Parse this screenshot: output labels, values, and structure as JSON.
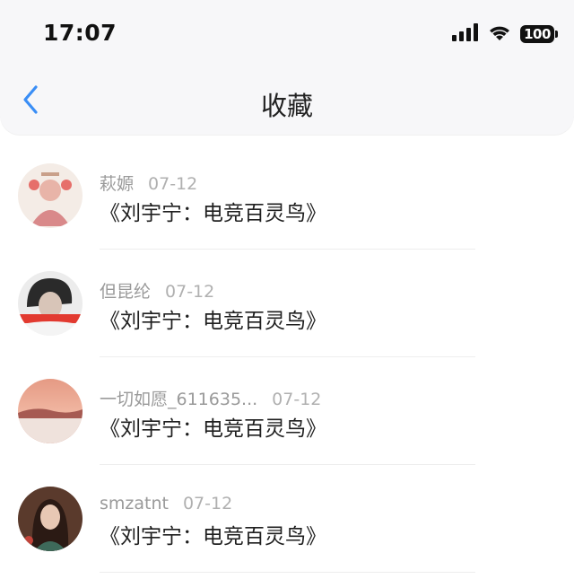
{
  "status_bar": {
    "time": "17:07",
    "battery": "100"
  },
  "nav": {
    "title": "收藏",
    "back_icon": "chevron-left-icon",
    "accent_color": "#3a8ef6"
  },
  "items": [
    {
      "author": "萩嫄",
      "date": "07-12",
      "title": "《刘宇宁：电竞百灵鸟》",
      "avatar": "avatar-1"
    },
    {
      "author": "但昆纶",
      "date": "07-12",
      "title": "《刘宇宁：电竞百灵鸟》",
      "avatar": "avatar-2"
    },
    {
      "author": "一切如愿_611635...",
      "date": "07-12",
      "title": "《刘宇宁：电竞百灵鸟》",
      "avatar": "avatar-3"
    },
    {
      "author": "smzatnt",
      "date": "07-12",
      "title": "《刘宇宁：电竞百灵鸟》",
      "avatar": "avatar-4"
    }
  ]
}
